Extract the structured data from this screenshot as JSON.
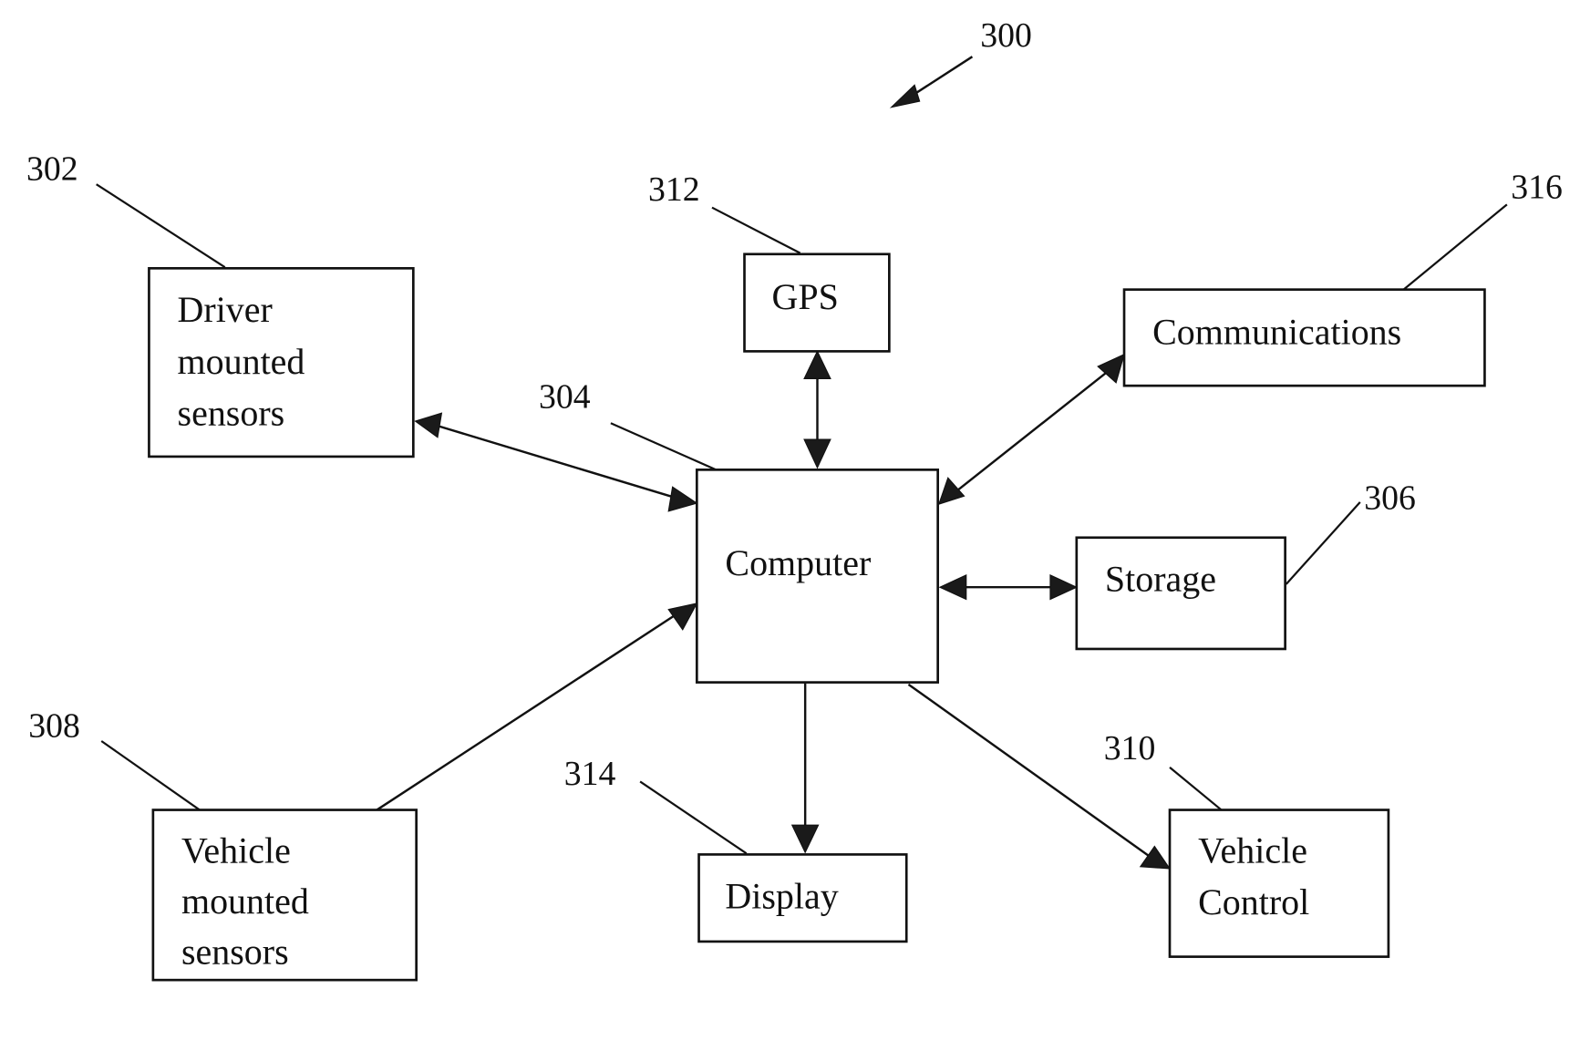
{
  "figure": {
    "reference": "300"
  },
  "blocks": {
    "driver_sensors": {
      "ref": "302",
      "lines": [
        "Driver",
        "mounted",
        "sensors"
      ]
    },
    "computer": {
      "ref": "304",
      "lines": [
        "Computer"
      ]
    },
    "storage": {
      "ref": "306",
      "lines": [
        "Storage"
      ]
    },
    "vehicle_sensors": {
      "ref": "308",
      "lines": [
        "Vehicle",
        "mounted",
        "sensors"
      ]
    },
    "vehicle_control": {
      "ref": "310",
      "lines": [
        "Vehicle",
        "Control"
      ]
    },
    "gps": {
      "ref": "312",
      "lines": [
        "GPS"
      ]
    },
    "display": {
      "ref": "314",
      "lines": [
        "Display"
      ]
    },
    "communications": {
      "ref": "316",
      "lines": [
        "Communications"
      ]
    }
  },
  "connections": [
    {
      "from": "driver_sensors",
      "to": "computer",
      "direction": "bidirectional"
    },
    {
      "from": "gps",
      "to": "computer",
      "direction": "bidirectional"
    },
    {
      "from": "communications",
      "to": "computer",
      "direction": "bidirectional"
    },
    {
      "from": "storage",
      "to": "computer",
      "direction": "bidirectional"
    },
    {
      "from": "vehicle_sensors",
      "to": "computer",
      "direction": "to-computer"
    },
    {
      "from": "computer",
      "to": "display",
      "direction": "to-display"
    },
    {
      "from": "computer",
      "to": "vehicle_control",
      "direction": "to-vehicle-control"
    }
  ]
}
